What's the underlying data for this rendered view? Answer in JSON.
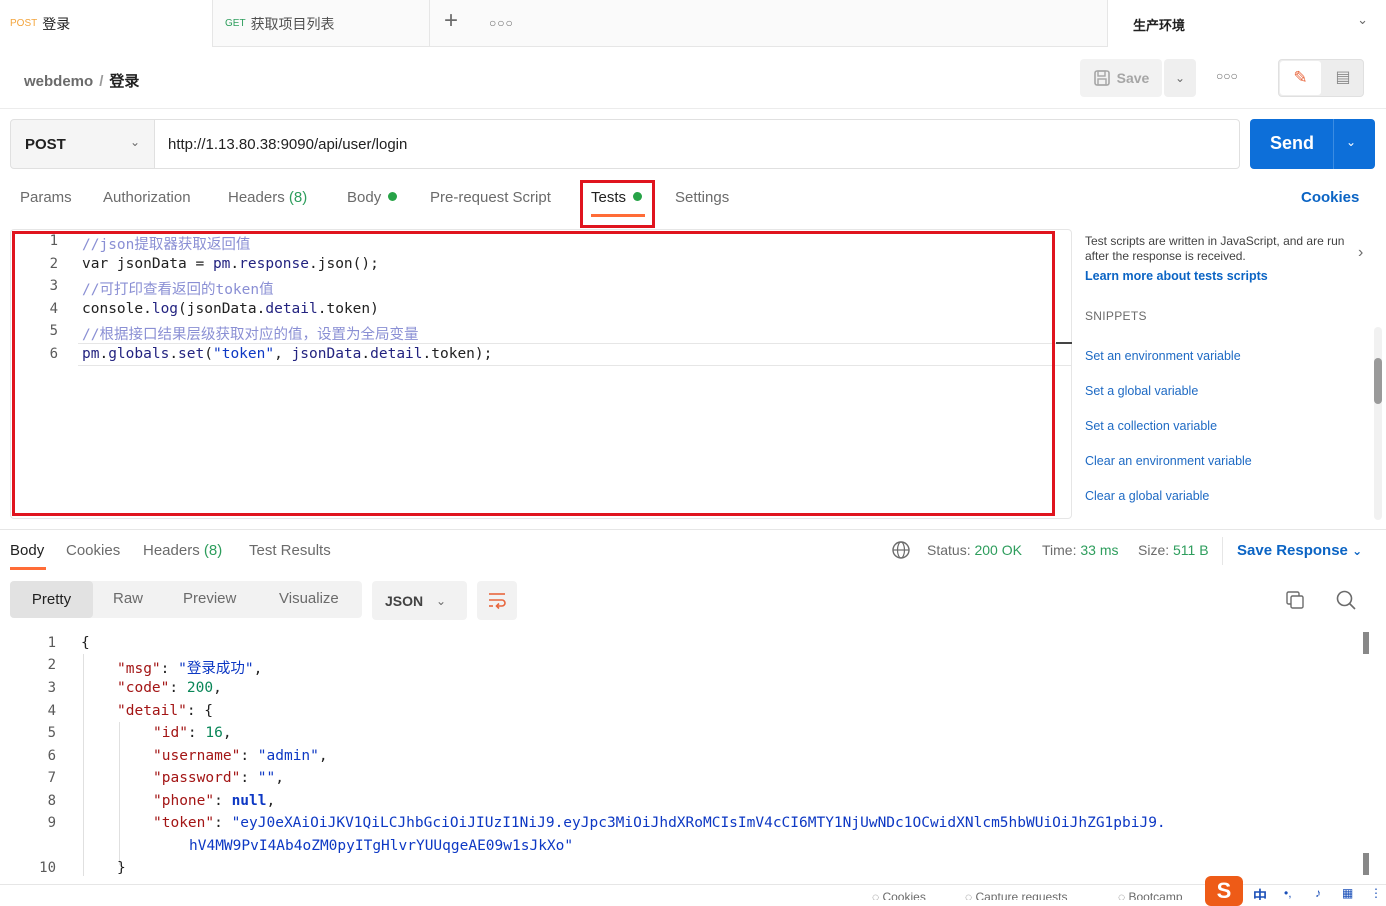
{
  "tabs": [
    {
      "method": "POST",
      "label": "登录"
    },
    {
      "method": "GET",
      "label": "获取项目列表"
    }
  ],
  "environment": "生产环境",
  "breadcrumb": {
    "collection": "webdemo",
    "separator": "/",
    "request": "登录"
  },
  "toolbar": {
    "save_label": "Save"
  },
  "request": {
    "method": "POST",
    "url": "http://1.13.80.38:9090/api/user/login",
    "send_label": "Send"
  },
  "request_tabs": {
    "params": "Params",
    "authorization": "Authorization",
    "headers": "Headers",
    "headers_count": "(8)",
    "body": "Body",
    "prerequest": "Pre-request Script",
    "tests": "Tests",
    "settings": "Settings",
    "cookies": "Cookies"
  },
  "editor": {
    "lines": [
      {
        "n": "1",
        "parts": [
          {
            "t": "//json提取器获取返回值",
            "c": "cm"
          }
        ]
      },
      {
        "n": "2",
        "parts": [
          {
            "t": "var jsonData = ",
            "c": ""
          },
          {
            "t": "pm",
            "c": "fn"
          },
          {
            "t": ".",
            "c": ""
          },
          {
            "t": "response",
            "c": "fn"
          },
          {
            "t": ".json();",
            "c": ""
          }
        ]
      },
      {
        "n": "3",
        "parts": [
          {
            "t": "//可打印查看返回的token值",
            "c": "cm"
          }
        ]
      },
      {
        "n": "4",
        "parts": [
          {
            "t": "console",
            "c": ""
          },
          {
            "t": ".",
            "c": ""
          },
          {
            "t": "log",
            "c": "fn"
          },
          {
            "t": "(jsonData.",
            "c": ""
          },
          {
            "t": "detail",
            "c": "fn"
          },
          {
            "t": ".token)",
            "c": ""
          }
        ]
      },
      {
        "n": "5",
        "parts": [
          {
            "t": "//根据接口结果层级获取对应的值，设置为全局变量",
            "c": "cm"
          }
        ]
      },
      {
        "n": "6",
        "parts": [
          {
            "t": "pm",
            "c": "fn"
          },
          {
            "t": ".",
            "c": ""
          },
          {
            "t": "globals",
            "c": "fn"
          },
          {
            "t": ".",
            "c": ""
          },
          {
            "t": "set",
            "c": "fn"
          },
          {
            "t": "(",
            "c": ""
          },
          {
            "t": "\"token\"",
            "c": "str"
          },
          {
            "t": ", ",
            "c": ""
          },
          {
            "t": "jsonData",
            "c": "fn"
          },
          {
            "t": ".",
            "c": ""
          },
          {
            "t": "detail",
            "c": "fn"
          },
          {
            "t": ".token);",
            "c": ""
          }
        ]
      }
    ]
  },
  "snippets": {
    "info": "Test scripts are written in JavaScript, and are run after the response is received.",
    "learn_more": "Learn more about tests scripts",
    "heading": "SNIPPETS",
    "items": [
      "Set an environment variable",
      "Set a global variable",
      "Set a collection variable",
      "Clear an environment variable",
      "Clear a global variable"
    ]
  },
  "response_tabs": {
    "body": "Body",
    "cookies": "Cookies",
    "headers": "Headers",
    "headers_count": "(8)",
    "test_results": "Test Results"
  },
  "response_meta": {
    "status_label": "Status:",
    "status_value": "200 OK",
    "time_label": "Time:",
    "time_value": "33 ms",
    "size_label": "Size:",
    "size_value": "511 B",
    "save_response": "Save Response"
  },
  "view_options": {
    "pretty": "Pretty",
    "raw": "Raw",
    "preview": "Preview",
    "visualize": "Visualize",
    "format": "JSON"
  },
  "response_body": {
    "lines": [
      {
        "n": "1",
        "indent": 0,
        "parts": [
          {
            "t": "{",
            "c": "pn"
          }
        ]
      },
      {
        "n": "2",
        "indent": 1,
        "parts": [
          {
            "t": "\"msg\"",
            "c": "key"
          },
          {
            "t": ": ",
            "c": "pn"
          },
          {
            "t": "\"登录成功\"",
            "c": "sv"
          },
          {
            "t": ",",
            "c": "pn"
          }
        ]
      },
      {
        "n": "3",
        "indent": 1,
        "parts": [
          {
            "t": "\"code\"",
            "c": "key"
          },
          {
            "t": ": ",
            "c": "pn"
          },
          {
            "t": "200",
            "c": "nv"
          },
          {
            "t": ",",
            "c": "pn"
          }
        ]
      },
      {
        "n": "4",
        "indent": 1,
        "parts": [
          {
            "t": "\"detail\"",
            "c": "key"
          },
          {
            "t": ": {",
            "c": "pn"
          }
        ]
      },
      {
        "n": "5",
        "indent": 2,
        "parts": [
          {
            "t": "\"id\"",
            "c": "key"
          },
          {
            "t": ": ",
            "c": "pn"
          },
          {
            "t": "16",
            "c": "nv"
          },
          {
            "t": ",",
            "c": "pn"
          }
        ]
      },
      {
        "n": "6",
        "indent": 2,
        "parts": [
          {
            "t": "\"username\"",
            "c": "key"
          },
          {
            "t": ": ",
            "c": "pn"
          },
          {
            "t": "\"admin\"",
            "c": "sv"
          },
          {
            "t": ",",
            "c": "pn"
          }
        ]
      },
      {
        "n": "7",
        "indent": 2,
        "parts": [
          {
            "t": "\"password\"",
            "c": "key"
          },
          {
            "t": ": ",
            "c": "pn"
          },
          {
            "t": "\"\"",
            "c": "sv"
          },
          {
            "t": ",",
            "c": "pn"
          }
        ]
      },
      {
        "n": "8",
        "indent": 2,
        "parts": [
          {
            "t": "\"phone\"",
            "c": "key"
          },
          {
            "t": ": ",
            "c": "pn"
          },
          {
            "t": "null",
            "c": "nl"
          },
          {
            "t": ",",
            "c": "pn"
          }
        ]
      },
      {
        "n": "9",
        "indent": 2,
        "parts": [
          {
            "t": "\"token\"",
            "c": "key"
          },
          {
            "t": ": ",
            "c": "pn"
          },
          {
            "t": "\"eyJ0eXAiOiJKV1QiLCJhbGciOiJIUzI1NiJ9.eyJpc3MiOiJhdXRoMCIsImV4cCI6MTY1NjUwNDc1OCwidXNlcm5hbWUiOiJhZG1pbiJ9.",
            "c": "sv"
          }
        ]
      },
      {
        "n": "",
        "indent": 3,
        "parts": [
          {
            "t": "hV4MW9PvI4Ab4oZM0pyITgHlvrYUUqgeAE09w1sJkXo\"",
            "c": "sv"
          }
        ]
      },
      {
        "n": "10",
        "indent": 1,
        "parts": [
          {
            "t": "}",
            "c": "pn"
          }
        ]
      }
    ]
  },
  "statusbar": {
    "cookies": "Cookies",
    "capture": "Capture requests",
    "bootcamp": "Bootcamp"
  },
  "ime": {
    "logo": "S",
    "mode": "中"
  },
  "colors": {
    "accent": "#ff6c37",
    "send": "#0d6fd9",
    "highlight_box": "#e0141e",
    "status_ok": "#2d9d5c"
  }
}
